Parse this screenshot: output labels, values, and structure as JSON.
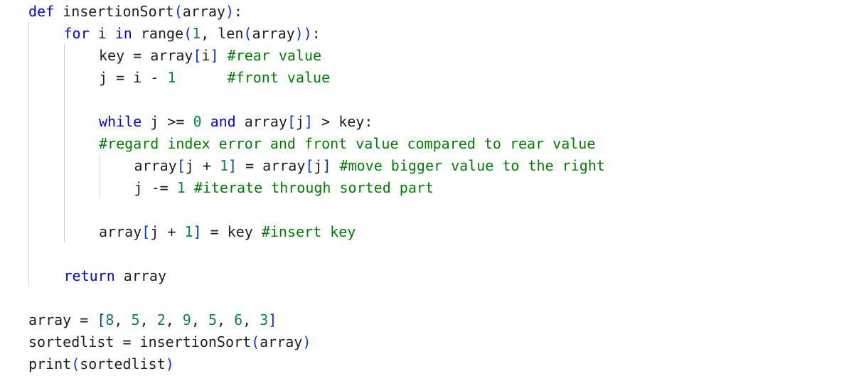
{
  "editor": {
    "lines": [
      {
        "indent": 0,
        "tokens": [
          [
            "kw",
            "def"
          ],
          [
            "pl",
            " insertionSort"
          ],
          [
            "br",
            "("
          ],
          [
            "pl",
            "array"
          ],
          [
            "br",
            ")"
          ],
          [
            "pl",
            ":"
          ]
        ]
      },
      {
        "indent": 1,
        "tokens": [
          [
            "kw",
            "for"
          ],
          [
            "pl",
            " i "
          ],
          [
            "kw",
            "in"
          ],
          [
            "pl",
            " range"
          ],
          [
            "br",
            "("
          ],
          [
            "num",
            "1"
          ],
          [
            "pl",
            ", len"
          ],
          [
            "br",
            "("
          ],
          [
            "pl",
            "array"
          ],
          [
            "br",
            "))"
          ],
          [
            "pl",
            ":"
          ]
        ]
      },
      {
        "indent": 2,
        "tokens": [
          [
            "pl",
            "key = array"
          ],
          [
            "br",
            "["
          ],
          [
            "pl",
            "i"
          ],
          [
            "br",
            "]"
          ],
          [
            "pl",
            " "
          ],
          [
            "cm",
            "#rear value"
          ]
        ]
      },
      {
        "indent": 2,
        "tokens": [
          [
            "pl",
            "j = i - "
          ],
          [
            "num",
            "1"
          ],
          [
            "pl",
            "      "
          ],
          [
            "cm",
            "#front value"
          ]
        ]
      },
      {
        "indent": 0,
        "tokens": []
      },
      {
        "indent": 2,
        "tokens": [
          [
            "kw",
            "while"
          ],
          [
            "pl",
            " j >= "
          ],
          [
            "num",
            "0"
          ],
          [
            "pl",
            " "
          ],
          [
            "kw",
            "and"
          ],
          [
            "pl",
            " array"
          ],
          [
            "br",
            "["
          ],
          [
            "pl",
            "j"
          ],
          [
            "br",
            "]"
          ],
          [
            "pl",
            " > key:"
          ]
        ]
      },
      {
        "indent": 2,
        "tokens": [
          [
            "cm",
            "#regard index error and front value compared to rear value"
          ]
        ]
      },
      {
        "indent": 3,
        "tokens": [
          [
            "pl",
            "array"
          ],
          [
            "br",
            "["
          ],
          [
            "pl",
            "j + "
          ],
          [
            "num",
            "1"
          ],
          [
            "br",
            "]"
          ],
          [
            "pl",
            " = array"
          ],
          [
            "br",
            "["
          ],
          [
            "pl",
            "j"
          ],
          [
            "br",
            "]"
          ],
          [
            "pl",
            " "
          ],
          [
            "cm",
            "#move bigger value to the right"
          ]
        ]
      },
      {
        "indent": 3,
        "tokens": [
          [
            "pl",
            "j -= "
          ],
          [
            "num",
            "1"
          ],
          [
            "pl",
            " "
          ],
          [
            "cm",
            "#iterate through sorted part"
          ]
        ]
      },
      {
        "indent": 0,
        "tokens": []
      },
      {
        "indent": 2,
        "tokens": [
          [
            "pl",
            "array"
          ],
          [
            "br",
            "["
          ],
          [
            "pl",
            "j + "
          ],
          [
            "num",
            "1"
          ],
          [
            "br",
            "]"
          ],
          [
            "pl",
            " = key "
          ],
          [
            "cm",
            "#insert key"
          ]
        ]
      },
      {
        "indent": 0,
        "tokens": []
      },
      {
        "indent": 1,
        "tokens": [
          [
            "kw",
            "return"
          ],
          [
            "pl",
            " array"
          ]
        ]
      },
      {
        "indent": 0,
        "tokens": []
      },
      {
        "indent": 0,
        "tokens": [
          [
            "pl",
            "array = "
          ],
          [
            "br",
            "["
          ],
          [
            "num",
            "8"
          ],
          [
            "pl",
            ", "
          ],
          [
            "num",
            "5"
          ],
          [
            "pl",
            ", "
          ],
          [
            "num",
            "2"
          ],
          [
            "pl",
            ", "
          ],
          [
            "num",
            "9"
          ],
          [
            "pl",
            ", "
          ],
          [
            "num",
            "5"
          ],
          [
            "pl",
            ", "
          ],
          [
            "num",
            "6"
          ],
          [
            "pl",
            ", "
          ],
          [
            "num",
            "3"
          ],
          [
            "br",
            "]"
          ]
        ]
      },
      {
        "indent": 0,
        "tokens": [
          [
            "pl",
            "sortedlist = insertionSort"
          ],
          [
            "br",
            "("
          ],
          [
            "pl",
            "array"
          ],
          [
            "br",
            ")"
          ]
        ]
      },
      {
        "indent": 0,
        "tokens": [
          [
            "pl",
            "print"
          ],
          [
            "br",
            "("
          ],
          [
            "pl",
            "sortedlist"
          ],
          [
            "br",
            ")"
          ]
        ]
      }
    ]
  }
}
